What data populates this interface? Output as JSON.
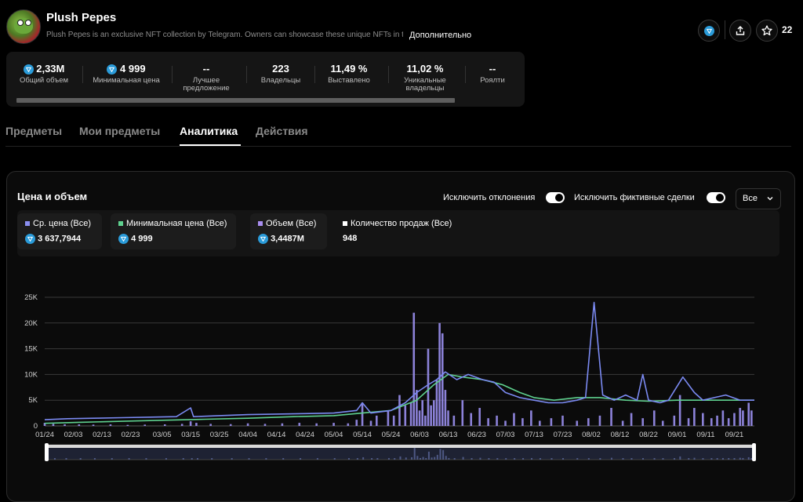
{
  "collection": {
    "title": "Plush Pepes",
    "description": "Plush Pepes is an exclusive NFT collection by Telegram. Owners can showcase these unique NFTs in the",
    "more_label": "Дополнительно",
    "favorites_count": "22"
  },
  "stats": [
    {
      "value": "2,33M",
      "label": "Общий объем",
      "ton": true
    },
    {
      "value": "4 999",
      "label": "Минимальная цена",
      "ton": true
    },
    {
      "value": "--",
      "label": "Лучшее предложение",
      "ton": false
    },
    {
      "value": "223",
      "label": "Владельцы",
      "ton": false
    },
    {
      "value": "11,49 %",
      "label": "Выставлено",
      "ton": false
    },
    {
      "value": "11,02 %",
      "label": "Уникальные владельцы",
      "ton": false
    },
    {
      "value": "--",
      "label": "Роялти",
      "ton": false
    }
  ],
  "tabs": [
    "Предметы",
    "Мои предметы",
    "Аналитика",
    "Действия"
  ],
  "active_tab": "Аналитика",
  "panel": {
    "title": "Цена и объем",
    "toggle1": "Исключить отклонения",
    "toggle2": "Исключить фиктивные сделки",
    "select_value": "Все"
  },
  "legend": [
    {
      "label": "Ср. цена (Все)",
      "value": "3 637,7944",
      "color": "#8a8ef0",
      "ton": true
    },
    {
      "label": "Минимальная цена (Все)",
      "value": "4 999",
      "color": "#5fd18f",
      "ton": true
    },
    {
      "label": "Объем (Все)",
      "value": "3,4487M",
      "color": "#a98ef0",
      "ton": true
    },
    {
      "label": "Количество продаж (Все)",
      "value": "948",
      "color": "#ffffff",
      "ton": false
    }
  ],
  "icons": [
    "ton-icon",
    "share-icon",
    "star-icon",
    "chevron-down-icon"
  ],
  "colors": {
    "avg_price": "#7b8af2",
    "min_price": "#5fd18f",
    "volume": "#9a8ff0"
  },
  "chart_data": {
    "type": "bar",
    "y_ticks": [
      "0",
      "5K",
      "10K",
      "15K",
      "20K",
      "25K"
    ],
    "ylim": [
      0,
      25000
    ],
    "x_ticks": [
      "01/24",
      "02/03",
      "02/13",
      "02/23",
      "03/05",
      "03/15",
      "03/25",
      "04/04",
      "04/14",
      "04/24",
      "05/04",
      "05/14",
      "05/24",
      "06/03",
      "06/13",
      "06/23",
      "07/03",
      "07/13",
      "07/23",
      "08/02",
      "08/12",
      "08/22",
      "09/01",
      "09/11",
      "09/21"
    ],
    "x_start": "2024-01-24",
    "x_end": "2024-09-28",
    "series": [
      {
        "name": "Объем (Все)",
        "kind": "bar",
        "points": [
          [
            "2024-01-24",
            600
          ],
          [
            "2024-01-27",
            400
          ],
          [
            "2024-01-31",
            300
          ],
          [
            "2024-02-05",
            300
          ],
          [
            "2024-02-10",
            250
          ],
          [
            "2024-02-16",
            300
          ],
          [
            "2024-02-22",
            200
          ],
          [
            "2024-02-28",
            250
          ],
          [
            "2024-03-06",
            300
          ],
          [
            "2024-03-12",
            400
          ],
          [
            "2024-03-15",
            900
          ],
          [
            "2024-03-17",
            600
          ],
          [
            "2024-03-22",
            400
          ],
          [
            "2024-03-29",
            350
          ],
          [
            "2024-04-04",
            500
          ],
          [
            "2024-04-10",
            400
          ],
          [
            "2024-04-16",
            500
          ],
          [
            "2024-04-22",
            600
          ],
          [
            "2024-04-28",
            500
          ],
          [
            "2024-05-04",
            600
          ],
          [
            "2024-05-09",
            500
          ],
          [
            "2024-05-12",
            1200
          ],
          [
            "2024-05-14",
            4500
          ],
          [
            "2024-05-17",
            1000
          ],
          [
            "2024-05-19",
            2000
          ],
          [
            "2024-05-23",
            3000
          ],
          [
            "2024-05-25",
            2000
          ],
          [
            "2024-05-27",
            6000
          ],
          [
            "2024-05-29",
            4000
          ],
          [
            "2024-05-31",
            4500
          ],
          [
            "2024-06-01",
            22000
          ],
          [
            "2024-06-02",
            7000
          ],
          [
            "2024-06-03",
            3000
          ],
          [
            "2024-06-04",
            5000
          ],
          [
            "2024-06-05",
            2000
          ],
          [
            "2024-06-06",
            15000
          ],
          [
            "2024-06-07",
            4000
          ],
          [
            "2024-06-08",
            5000
          ],
          [
            "2024-06-09",
            9000
          ],
          [
            "2024-06-10",
            20000
          ],
          [
            "2024-06-11",
            18000
          ],
          [
            "2024-06-12",
            7000
          ],
          [
            "2024-06-13",
            3000
          ],
          [
            "2024-06-15",
            2000
          ],
          [
            "2024-06-18",
            5000
          ],
          [
            "2024-06-21",
            2500
          ],
          [
            "2024-06-24",
            3500
          ],
          [
            "2024-06-27",
            1500
          ],
          [
            "2024-06-30",
            2000
          ],
          [
            "2024-07-03",
            1000
          ],
          [
            "2024-07-06",
            2500
          ],
          [
            "2024-07-09",
            1500
          ],
          [
            "2024-07-12",
            3000
          ],
          [
            "2024-07-15",
            1000
          ],
          [
            "2024-07-19",
            1500
          ],
          [
            "2024-07-23",
            2000
          ],
          [
            "2024-07-28",
            1000
          ],
          [
            "2024-08-01",
            1500
          ],
          [
            "2024-08-05",
            2000
          ],
          [
            "2024-08-09",
            3500
          ],
          [
            "2024-08-13",
            1000
          ],
          [
            "2024-08-16",
            2500
          ],
          [
            "2024-08-20",
            1500
          ],
          [
            "2024-08-24",
            3000
          ],
          [
            "2024-08-27",
            1000
          ],
          [
            "2024-08-31",
            2000
          ],
          [
            "2024-09-02",
            6000
          ],
          [
            "2024-09-05",
            1500
          ],
          [
            "2024-09-07",
            3500
          ],
          [
            "2024-09-10",
            2500
          ],
          [
            "2024-09-13",
            1500
          ],
          [
            "2024-09-15",
            2000
          ],
          [
            "2024-09-17",
            3000
          ],
          [
            "2024-09-19",
            1500
          ],
          [
            "2024-09-21",
            2500
          ],
          [
            "2024-09-23",
            3500
          ],
          [
            "2024-09-24",
            3000
          ],
          [
            "2024-09-26",
            4500
          ],
          [
            "2024-09-27",
            3000
          ]
        ]
      },
      {
        "name": "Ср. цена (Все)",
        "kind": "line",
        "points": [
          [
            "2024-01-24",
            1200
          ],
          [
            "2024-02-01",
            1400
          ],
          [
            "2024-02-10",
            1500
          ],
          [
            "2024-02-20",
            1600
          ],
          [
            "2024-03-01",
            1700
          ],
          [
            "2024-03-10",
            1800
          ],
          [
            "2024-03-15",
            3500
          ],
          [
            "2024-03-16",
            1800
          ],
          [
            "2024-03-25",
            2000
          ],
          [
            "2024-04-04",
            2200
          ],
          [
            "2024-04-14",
            2300
          ],
          [
            "2024-04-24",
            2400
          ],
          [
            "2024-05-04",
            2500
          ],
          [
            "2024-05-12",
            3000
          ],
          [
            "2024-05-14",
            4500
          ],
          [
            "2024-05-17",
            2500
          ],
          [
            "2024-05-24",
            3000
          ],
          [
            "2024-05-29",
            4500
          ],
          [
            "2024-06-02",
            6500
          ],
          [
            "2024-06-06",
            8000
          ],
          [
            "2024-06-09",
            9000
          ],
          [
            "2024-06-12",
            10500
          ],
          [
            "2024-06-16",
            9000
          ],
          [
            "2024-06-20",
            10000
          ],
          [
            "2024-06-25",
            9000
          ],
          [
            "2024-06-29",
            8500
          ],
          [
            "2024-07-03",
            6500
          ],
          [
            "2024-07-08",
            5500
          ],
          [
            "2024-07-13",
            5000
          ],
          [
            "2024-07-18",
            4500
          ],
          [
            "2024-07-23",
            4500
          ],
          [
            "2024-07-28",
            5000
          ],
          [
            "2024-07-31",
            5500
          ],
          [
            "2024-08-03",
            24000
          ],
          [
            "2024-08-06",
            6000
          ],
          [
            "2024-08-10",
            5000
          ],
          [
            "2024-08-14",
            6000
          ],
          [
            "2024-08-18",
            5000
          ],
          [
            "2024-08-20",
            10000
          ],
          [
            "2024-08-22",
            5000
          ],
          [
            "2024-08-26",
            4500
          ],
          [
            "2024-08-29",
            5000
          ],
          [
            "2024-09-03",
            9500
          ],
          [
            "2024-09-07",
            6500
          ],
          [
            "2024-09-10",
            5000
          ],
          [
            "2024-09-14",
            5500
          ],
          [
            "2024-09-18",
            6000
          ],
          [
            "2024-09-23",
            5000
          ],
          [
            "2024-09-28",
            5000
          ]
        ]
      },
      {
        "name": "Минимальная цена (Все)",
        "kind": "line",
        "points": [
          [
            "2024-01-24",
            500
          ],
          [
            "2024-02-05",
            700
          ],
          [
            "2024-02-20",
            900
          ],
          [
            "2024-03-05",
            1100
          ],
          [
            "2024-03-20",
            1300
          ],
          [
            "2024-04-04",
            1500
          ],
          [
            "2024-04-20",
            1800
          ],
          [
            "2024-05-04",
            2000
          ],
          [
            "2024-05-14",
            2500
          ],
          [
            "2024-05-24",
            3000
          ],
          [
            "2024-06-02",
            5000
          ],
          [
            "2024-06-08",
            8000
          ],
          [
            "2024-06-13",
            10000
          ],
          [
            "2024-06-18",
            9500
          ],
          [
            "2024-06-25",
            9000
          ],
          [
            "2024-07-02",
            8000
          ],
          [
            "2024-07-08",
            6500
          ],
          [
            "2024-07-13",
            5500
          ],
          [
            "2024-07-20",
            5000
          ],
          [
            "2024-07-28",
            5500
          ],
          [
            "2024-08-05",
            5500
          ],
          [
            "2024-08-14",
            5000
          ],
          [
            "2024-08-22",
            4800
          ],
          [
            "2024-09-01",
            5000
          ],
          [
            "2024-09-10",
            5000
          ],
          [
            "2024-09-20",
            5000
          ],
          [
            "2024-09-28",
            5000
          ]
        ]
      }
    ]
  }
}
